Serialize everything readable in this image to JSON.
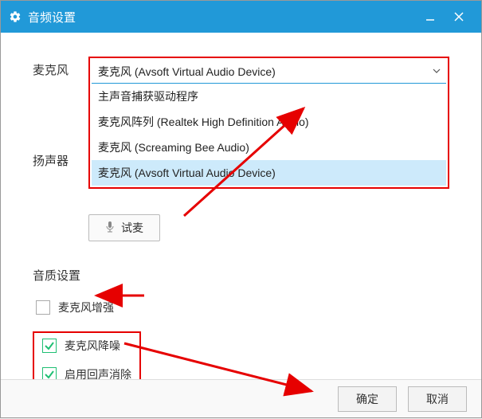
{
  "titlebar": {
    "title": "音频设置"
  },
  "labels": {
    "microphone": "麦克风",
    "speaker": "扬声器",
    "quality_section": "音质设置"
  },
  "microphone_dropdown": {
    "selected": "麦克风 (Avsoft Virtual Audio Device)",
    "options": [
      "主声音捕获驱动程序",
      "麦克风阵列 (Realtek High Definition Audio)",
      "麦克风 (Screaming Bee Audio)",
      "麦克风 (Avsoft Virtual Audio Device)"
    ]
  },
  "test_button": "试麦",
  "checkboxes": {
    "enhance": {
      "label": "麦克风增强",
      "checked": false
    },
    "noise": {
      "label": "麦克风降噪",
      "checked": true
    },
    "echo": {
      "label": "启用回声消除",
      "checked": true
    }
  },
  "footer": {
    "ok": "确定",
    "cancel": "取消"
  }
}
